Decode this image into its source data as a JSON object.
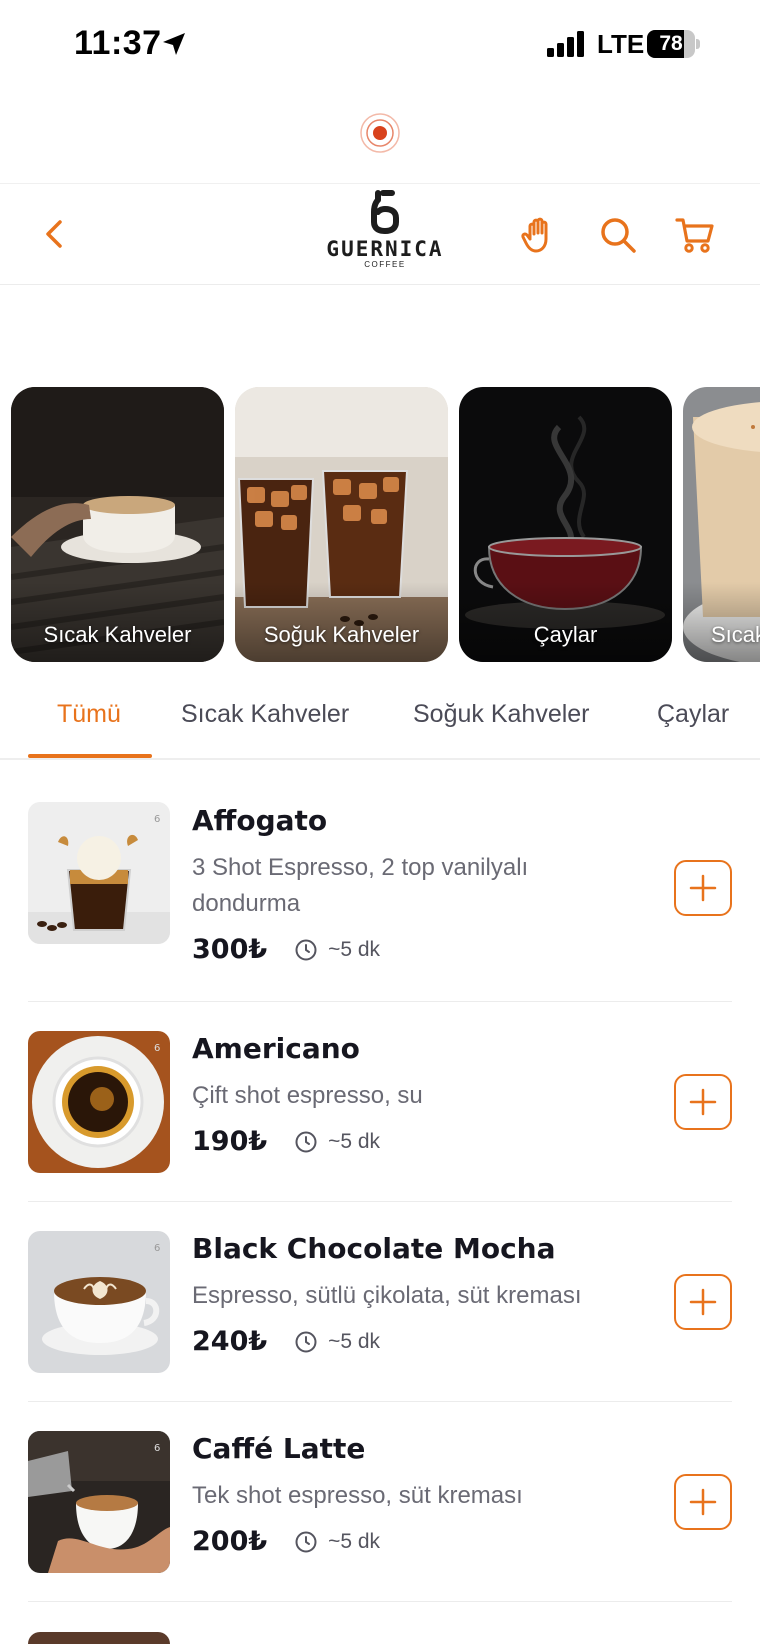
{
  "status_bar": {
    "time": "11:37",
    "network": "LTE",
    "battery": "78",
    "battery_level": 0.78
  },
  "header": {
    "logo_name": "GUERNICA",
    "logo_sub": "COFFEE",
    "icons": [
      "chevron-left-icon",
      "hand-icon",
      "search-icon",
      "cart-icon"
    ]
  },
  "categories": [
    {
      "label": "Sıcak Kahveler"
    },
    {
      "label": "Soğuk Kahveler"
    },
    {
      "label": "Çaylar"
    },
    {
      "label": "Sıcak"
    }
  ],
  "tabs": [
    {
      "label": "Tümü",
      "active": true
    },
    {
      "label": "Sıcak Kahveler",
      "active": false
    },
    {
      "label": "Soğuk Kahveler",
      "active": false
    },
    {
      "label": "Çaylar",
      "active": false
    }
  ],
  "products": [
    {
      "name": "Affogato",
      "description": "3 Shot Espresso, 2 top vanilyalı dondurma",
      "price": "300₺",
      "time": "~5 dk"
    },
    {
      "name": "Americano",
      "description": "Çift shot espresso, su",
      "price": "190₺",
      "time": "~5 dk"
    },
    {
      "name": "Black Chocolate Mocha",
      "description": "Espresso, sütlü çikolata, süt kreması",
      "price": "240₺",
      "time": "~5 dk"
    },
    {
      "name": "Caffé Latte",
      "description": "Tek shot espresso, süt kreması",
      "price": "200₺",
      "time": "~5 dk"
    }
  ],
  "colors": {
    "accent": "#e8731c",
    "text": "#16161f",
    "muted": "#6a6a74"
  }
}
